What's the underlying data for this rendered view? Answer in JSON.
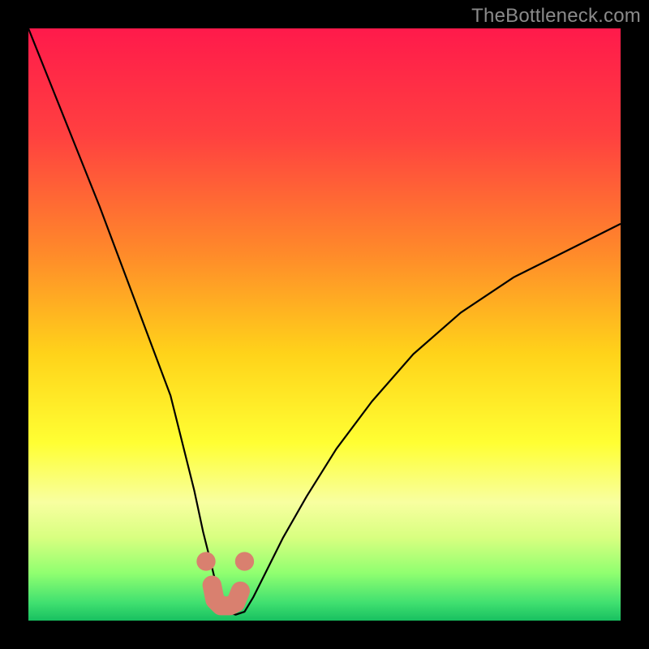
{
  "watermark": "TheBottleneck.com",
  "chart_data": {
    "type": "line",
    "title": "",
    "xlabel": "",
    "ylabel": "",
    "xlim": [
      0,
      100
    ],
    "ylim": [
      0,
      100
    ],
    "background_gradient": {
      "stops": [
        {
          "pos": 0.0,
          "color": "#ff1a4b"
        },
        {
          "pos": 0.18,
          "color": "#ff4040"
        },
        {
          "pos": 0.38,
          "color": "#ff8a2a"
        },
        {
          "pos": 0.55,
          "color": "#ffd31a"
        },
        {
          "pos": 0.7,
          "color": "#ffff33"
        },
        {
          "pos": 0.8,
          "color": "#f8ffa0"
        },
        {
          "pos": 0.86,
          "color": "#d8ff80"
        },
        {
          "pos": 0.92,
          "color": "#90ff70"
        },
        {
          "pos": 0.97,
          "color": "#40e070"
        },
        {
          "pos": 1.0,
          "color": "#18c060"
        }
      ]
    },
    "series": [
      {
        "name": "bottleneck-curve",
        "stroke": "#000000",
        "x": [
          0,
          4,
          8,
          12,
          15,
          18,
          21,
          24,
          26,
          28,
          29.5,
          31,
          32.2,
          33.5,
          35,
          36.5,
          38,
          40,
          43,
          47,
          52,
          58,
          65,
          73,
          82,
          92,
          100
        ],
        "y": [
          100,
          90,
          80,
          70,
          62,
          54,
          46,
          38,
          30,
          22,
          15,
          9,
          4,
          1.5,
          1,
          1.5,
          4,
          8,
          14,
          21,
          29,
          37,
          45,
          52,
          58,
          63,
          67
        ]
      }
    ],
    "highlight_near_minimum": {
      "color": "#d9806f",
      "dots": [
        {
          "x": 30.0,
          "y": 10.0
        },
        {
          "x": 36.5,
          "y": 10.0
        }
      ],
      "u_path": [
        {
          "x": 31.0,
          "y": 6.0
        },
        {
          "x": 31.5,
          "y": 3.5
        },
        {
          "x": 32.5,
          "y": 2.5
        },
        {
          "x": 34.0,
          "y": 2.5
        },
        {
          "x": 35.0,
          "y": 3.0
        },
        {
          "x": 35.8,
          "y": 5.0
        }
      ],
      "dot_radius": 1.6,
      "u_stroke_width": 3.2
    }
  }
}
